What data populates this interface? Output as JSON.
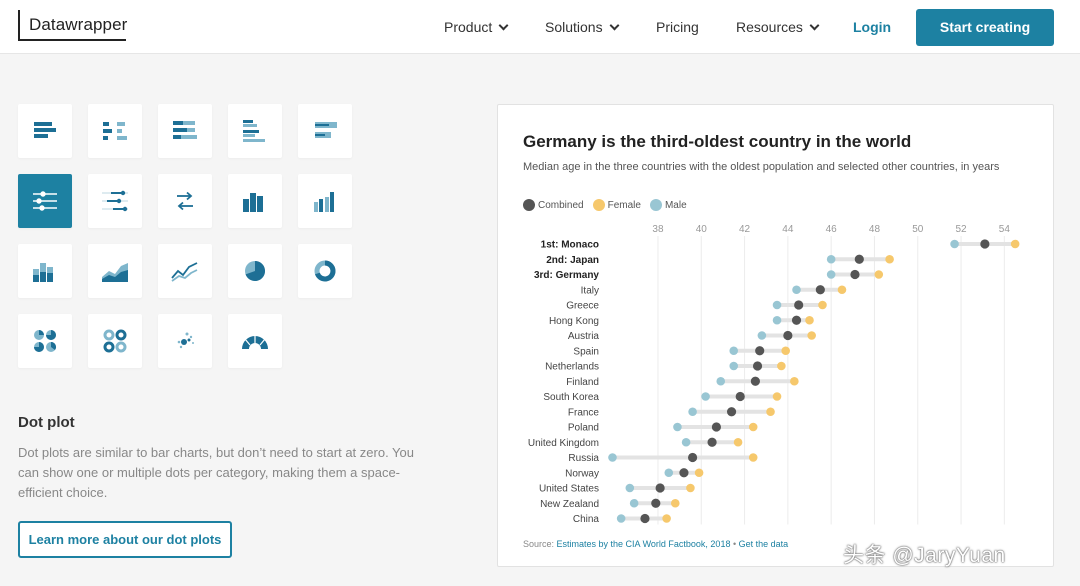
{
  "header": {
    "logo": "Datawrapper",
    "nav": [
      {
        "label": "Product",
        "dropdown": true
      },
      {
        "label": "Solutions",
        "dropdown": true
      },
      {
        "label": "Pricing",
        "dropdown": false
      },
      {
        "label": "Resources",
        "dropdown": true
      }
    ],
    "login": "Login",
    "cta": "Start creating"
  },
  "chart_types": {
    "active": "dot-plot",
    "tiles": [
      "bar-chart",
      "split-bars",
      "stacked-bars",
      "grouped-bars",
      "bullet-bars",
      "dot-plot",
      "range-plot",
      "arrow-plot",
      "column-chart",
      "grouped-column-chart",
      "stacked-column-chart",
      "area-chart",
      "line-chart",
      "pie-chart",
      "donut-chart",
      "multiple-pies",
      "multiple-donuts",
      "scatter-plot",
      "election-donut"
    ]
  },
  "description": {
    "title": "Dot plot",
    "text": "Dot plots are similar to bar charts, but don’t need to start at zero. You can show one or multiple dots per category, making them a space-efficient choice.",
    "button": "Learn more about our dot plots"
  },
  "chart_data": {
    "type": "scatter",
    "title": "Germany is the third-oldest country in the world",
    "subtitle": "Median age in the three countries with the oldest population and selected other countries, in years",
    "legend": [
      "Combined",
      "Female",
      "Male"
    ],
    "colors": {
      "combined": "#555555",
      "female": "#f6c86c",
      "male": "#99c6d3",
      "range": "#e3e3e3"
    },
    "xlim": [
      35.6,
      55
    ],
    "xticks": [
      38,
      40,
      42,
      44,
      46,
      48,
      50,
      52,
      54
    ],
    "categories": [
      "1st: Monaco",
      "2nd: Japan",
      "3rd: Germany",
      "Italy",
      "Greece",
      "Hong Kong",
      "Austria",
      "Spain",
      "Netherlands",
      "Finland",
      "South Korea",
      "France",
      "Poland",
      "United Kingdom",
      "Russia",
      "Norway",
      "United States",
      "New Zealand",
      "China"
    ],
    "bold_categories": [
      "1st: Monaco",
      "2nd: Japan",
      "3rd: Germany"
    ],
    "series": [
      {
        "name": "Combined",
        "values": [
          53.1,
          47.3,
          47.1,
          45.5,
          44.5,
          44.4,
          44.0,
          42.7,
          42.6,
          42.5,
          41.8,
          41.4,
          40.7,
          40.5,
          39.6,
          39.2,
          38.1,
          37.9,
          37.4
        ]
      },
      {
        "name": "Female",
        "values": [
          54.5,
          48.7,
          48.2,
          46.5,
          45.6,
          45.0,
          45.1,
          43.9,
          43.7,
          44.3,
          43.5,
          43.2,
          42.4,
          41.7,
          42.4,
          39.9,
          39.5,
          38.8,
          38.4
        ]
      },
      {
        "name": "Male",
        "values": [
          51.7,
          46.0,
          46.0,
          44.4,
          43.5,
          43.5,
          42.8,
          41.5,
          41.5,
          40.9,
          40.2,
          39.6,
          38.9,
          39.3,
          35.9,
          38.5,
          36.7,
          36.9,
          36.3
        ]
      }
    ],
    "source": {
      "prefix": "Source: ",
      "link": "Estimates by the CIA World Factbook, 2018",
      "sep": " • ",
      "data_link": "Get the data"
    }
  },
  "watermark": "头条 @JaryYuan"
}
